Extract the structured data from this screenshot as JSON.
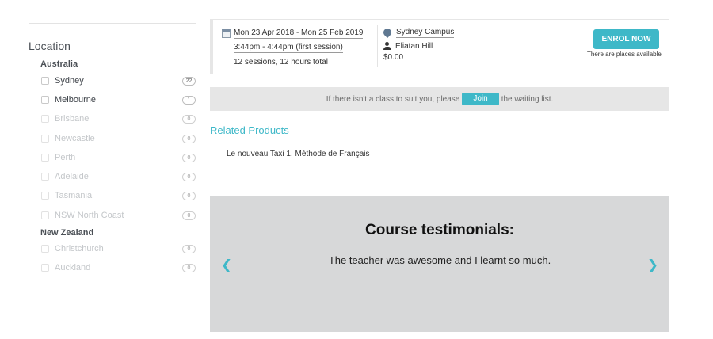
{
  "sidebar": {
    "title": "Location",
    "groups": [
      {
        "label": "Australia",
        "items": [
          {
            "label": "Sydney",
            "count": "22",
            "enabled": true
          },
          {
            "label": "Melbourne",
            "count": "1",
            "enabled": true
          },
          {
            "label": "Brisbane",
            "count": "0",
            "enabled": false
          },
          {
            "label": "Newcastle",
            "count": "0",
            "enabled": false
          },
          {
            "label": "Perth",
            "count": "0",
            "enabled": false
          },
          {
            "label": "Adelaide",
            "count": "0",
            "enabled": false
          },
          {
            "label": "Tasmania",
            "count": "0",
            "enabled": false
          },
          {
            "label": "NSW North Coast",
            "count": "0",
            "enabled": false
          }
        ]
      },
      {
        "label": "New Zealand",
        "items": [
          {
            "label": "Christchurch",
            "count": "0",
            "enabled": false
          },
          {
            "label": "Auckland",
            "count": "0",
            "enabled": false
          }
        ]
      }
    ]
  },
  "session": {
    "dates": "Mon 23 Apr 2018 - Mon 25 Feb 2019",
    "time": "3:44pm - 4:44pm (first session)",
    "total": "12 sessions, 12 hours total",
    "campus": "Sydney Campus",
    "teacher": "Eliatan Hill",
    "price": "$0.00",
    "enrol_label": "ENROL NOW",
    "availability": "There are places available",
    "icons": {
      "date": "calendar-icon",
      "location": "map-pin-icon",
      "teacher": "person-icon"
    }
  },
  "waiting": {
    "prefix": "If there isn't a class to suit you, please",
    "join_label": "Join",
    "suffix": "the waiting list."
  },
  "related": {
    "title": "Related Products",
    "item": "Le nouveau Taxi 1, Méthode de Français"
  },
  "testimonials": {
    "title": "Course testimonials:",
    "quote": "The teacher was awesome and I learnt so much.",
    "prev_icon": "chevron-left-icon",
    "next_icon": "chevron-right-icon"
  },
  "colors": {
    "accent": "#3eb8c8",
    "testimonial_bg": "#d7d8d9",
    "waitbar_bg": "#e6e6e6"
  }
}
